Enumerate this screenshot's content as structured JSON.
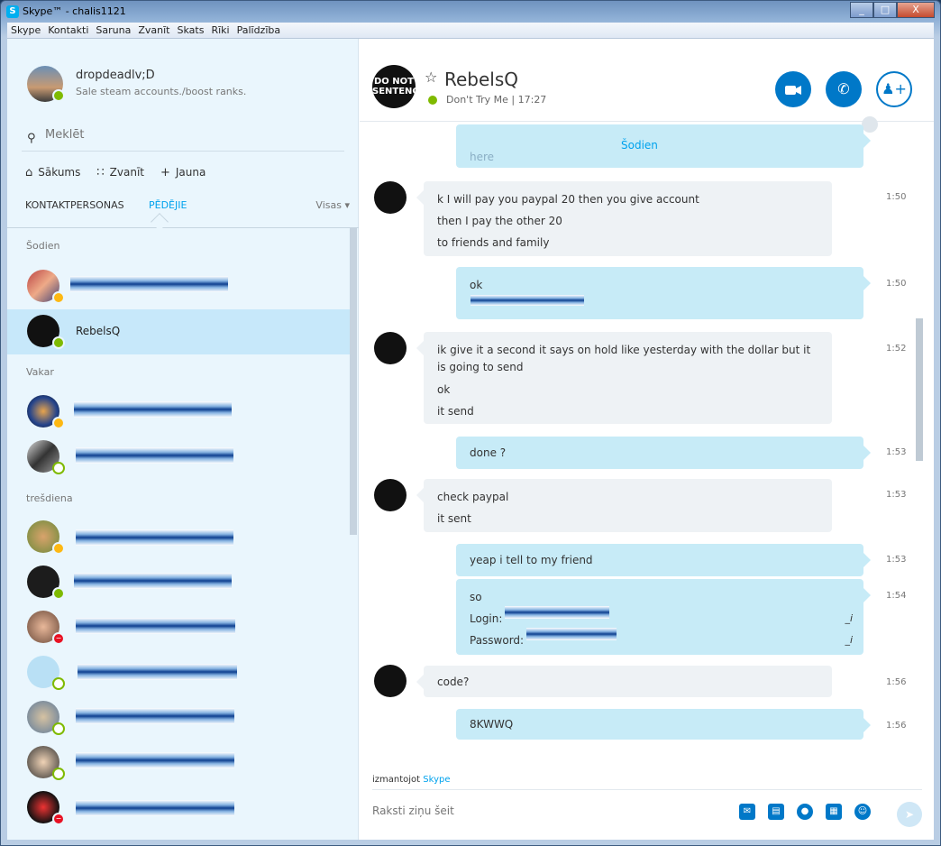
{
  "window": {
    "title": "Skype™ - chalis1121",
    "app_icon": "S",
    "buttons": {
      "minimize": "_",
      "maximize": "□",
      "close": "X"
    }
  },
  "menu": [
    "Skype",
    "Kontakti",
    "Saruna",
    "Zvanīt",
    "Skats",
    "Rīki",
    "Palīdzība"
  ],
  "me": {
    "name": "dropdeadlv;D",
    "mood": "Sale steam accounts./boost ranks."
  },
  "search": {
    "placeholder": "Meklēt"
  },
  "nav": {
    "home": "Sākums",
    "call": "Zvanīt",
    "new": "Jauna"
  },
  "tabs": {
    "contacts": "KONTAKTPERSONAS",
    "recent": "PĒDĒJIE",
    "filter": "Visas"
  },
  "groups": {
    "today": "Šodien",
    "yesterday": "Vakar",
    "wednesday": "trešdiena"
  },
  "contacts": {
    "active_name": "RebelsQ"
  },
  "chat": {
    "name": "RebelsQ",
    "mood": "Don't Try Me",
    "local_time": "17:27",
    "day_label": "Šodien",
    "avatar_text": "DO NOT SENTENCE",
    "messages": [
      {
        "lines": [
          "k I will pay you paypal 20 then you give account",
          "then I pay the other 20",
          "to friends and family"
        ],
        "time": "1:50"
      },
      {
        "lines": [
          "ok"
        ],
        "time": "1:50"
      },
      {
        "lines": [
          "ik give it a second it says on hold like yesterday with the dollar but it is going to send",
          "ok",
          "it send"
        ],
        "time": "1:52"
      },
      {
        "lines": [
          "done ?"
        ],
        "time": "1:53"
      },
      {
        "lines": [
          "check paypal",
          "it sent"
        ],
        "time": "1:53"
      },
      {
        "lines": [
          "yeap i tell to my friend"
        ],
        "time": "1:53"
      },
      {
        "lines": [
          "so",
          "Login:",
          "Password:"
        ],
        "time": "1:54"
      },
      {
        "lines": [
          "code?"
        ],
        "time": "1:56"
      },
      {
        "lines": [
          "8KWWQ"
        ],
        "time": "1:56"
      }
    ],
    "partial_top": "here",
    "edit_mark": "_i"
  },
  "composer": {
    "via_prefix": "izmantojot",
    "via_link": "Skype",
    "placeholder": "Raksti ziņu šeit"
  },
  "colors": {
    "accent": "#00a2ed",
    "button": "#0078c8",
    "online": "#7fba00",
    "away": "#fdb813",
    "busy": "#e81123"
  }
}
